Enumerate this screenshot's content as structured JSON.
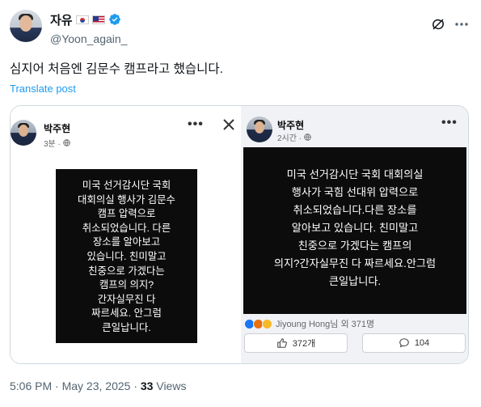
{
  "author": {
    "display_name": "자유",
    "handle": "@Yoon_again_",
    "flags": [
      "kr-flag",
      "us-flag"
    ],
    "verified": true
  },
  "tweet": {
    "text": "심지어 처음엔 김문수 캠프라고 했습니다.",
    "translate_label": "Translate post"
  },
  "media": {
    "left_post": {
      "author": "박주현",
      "time": "3분 ·",
      "more": "•••",
      "lines": [
        "미국 선거감시단 국회",
        "대회의실 행사가 김문수",
        "캠프 압력으로",
        "취소되었습니다. 다른",
        "장소를 알아보고",
        "있습니다. 친미말고",
        "친중으로 가겠다는",
        "캠프의 의지?",
        "간자실무진 다",
        "짜르세요. 안그럼",
        "큰일납니다."
      ]
    },
    "right_post": {
      "author": "박주현",
      "time": "2시간 ·",
      "more": "•••",
      "lines": [
        "미국 선거감시단 국회 대회의실",
        "행사가 국힘 선대위 압력으로",
        "취소되었습니다.다른 장소를",
        "알아보고 있습니다. 친미말고",
        "친중으로 가겠다는 캠프의",
        "의지?간자실무진 다 짜르세요.안그럼",
        "큰일납니다."
      ],
      "reactions_text": "Jiyoung Hong님 외 371명",
      "like_count": "372개",
      "comment_count": "104"
    }
  },
  "footer": {
    "time": "5:06 PM",
    "separator": " · ",
    "date": "May 23, 2025",
    "views_count": "33",
    "views_label": " Views"
  },
  "colors": {
    "link": "#1d9bf0",
    "verified": "#1d9bf0",
    "muted": "#536471"
  }
}
